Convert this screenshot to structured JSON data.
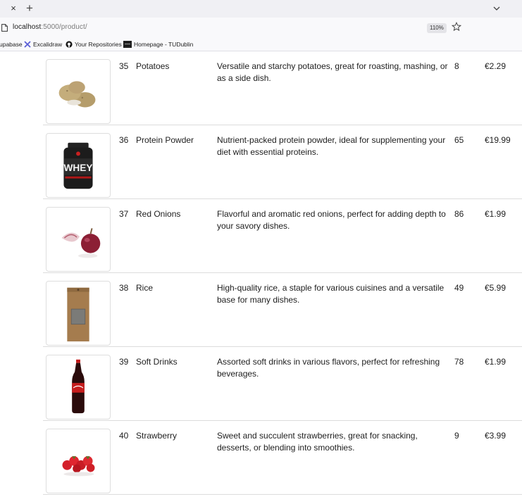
{
  "browser": {
    "tab": {
      "close_glyph": "×",
      "new_tab_glyph": "+"
    },
    "address": {
      "host": "localhost",
      "path": ":5000/product/",
      "zoom": "110%"
    },
    "bookmarks": [
      {
        "label": "upabase",
        "icon": "supabase-icon"
      },
      {
        "label": "Excalidraw",
        "icon": "excalidraw-icon"
      },
      {
        "label": "Your Repositories",
        "icon": "github-icon"
      },
      {
        "label": "Homepage - TUDublin",
        "icon": "tudublin-icon"
      }
    ]
  },
  "products": [
    {
      "id": "35",
      "name": "Potatoes",
      "description": "Versatile and starchy potatoes, great for roasting, mashing, or as a side dish.",
      "quantity": "8",
      "price": "€2.29",
      "image": "potatoes-image"
    },
    {
      "id": "36",
      "name": "Protein Powder",
      "description": "Nutrient-packed protein powder, ideal for supplementing your diet with essential proteins.",
      "quantity": "65",
      "price": "€19.99",
      "image": "protein-powder-image",
      "image_text": "WHEY"
    },
    {
      "id": "37",
      "name": "Red Onions",
      "description": "Flavorful and aromatic red onions, perfect for adding depth to your savory dishes.",
      "quantity": "86",
      "price": "€1.99",
      "image": "red-onions-image"
    },
    {
      "id": "38",
      "name": "Rice",
      "description": "High-quality rice, a staple for various cuisines and a versatile base for many dishes.",
      "quantity": "49",
      "price": "€5.99",
      "image": "rice-bag-image"
    },
    {
      "id": "39",
      "name": "Soft Drinks",
      "description": "Assorted soft drinks in various flavors, perfect for refreshing beverages.",
      "quantity": "78",
      "price": "€1.99",
      "image": "soft-drink-bottle-image"
    },
    {
      "id": "40",
      "name": "Strawberry",
      "description": "Sweet and succulent strawberries, great for snacking, desserts, or blending into smoothies.",
      "quantity": "9",
      "price": "€3.99",
      "image": "strawberries-image"
    }
  ]
}
